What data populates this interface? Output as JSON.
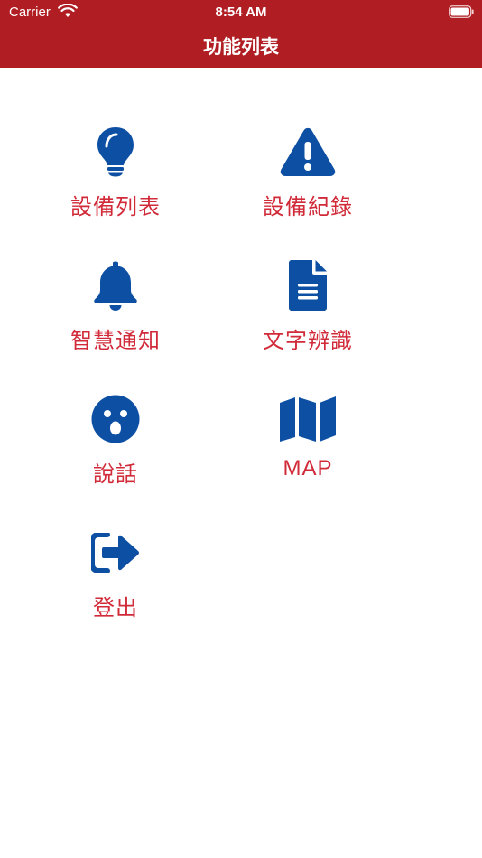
{
  "status_bar": {
    "carrier": "Carrier",
    "time": "8:54 AM"
  },
  "nav": {
    "title": "功能列表"
  },
  "colors": {
    "header_bg": "#b01e23",
    "icon": "#0d4fa3",
    "label": "#d12b3a"
  },
  "menu": [
    {
      "label": "設備列表",
      "icon": "lightbulb-icon"
    },
    {
      "label": "設備紀錄",
      "icon": "warning-icon"
    },
    {
      "label": "智慧通知",
      "icon": "bell-icon"
    },
    {
      "label": "文字辨識",
      "icon": "document-icon"
    },
    {
      "label": "說話",
      "icon": "surprised-face-icon"
    },
    {
      "label": "MAP",
      "icon": "map-icon"
    },
    {
      "label": "登出",
      "icon": "logout-icon"
    }
  ]
}
